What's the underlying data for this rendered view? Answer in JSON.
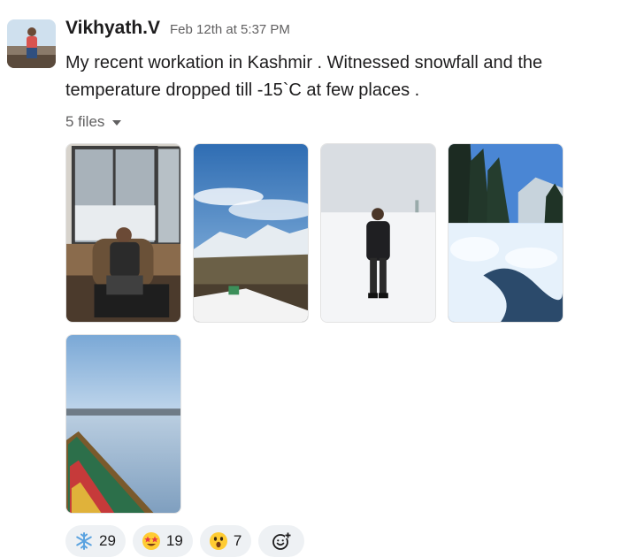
{
  "message": {
    "sender": "Vikhyath.V",
    "timestamp": "Feb 12th at 5:37 PM",
    "text": "My recent workation in Kashmir . Witnessed snowfall and the temperature dropped till -15`C at few places ."
  },
  "files": {
    "label": "5 files",
    "count": 5
  },
  "reactions": [
    {
      "emoji": "snowflake-icon",
      "count": "29"
    },
    {
      "emoji": "star-struck-icon",
      "count": "19"
    },
    {
      "emoji": "astonished-face-icon",
      "count": "7"
    }
  ],
  "colors": {
    "text": "#1d1c1d",
    "muted": "#616061",
    "reaction_bg": "#eef1f4"
  }
}
